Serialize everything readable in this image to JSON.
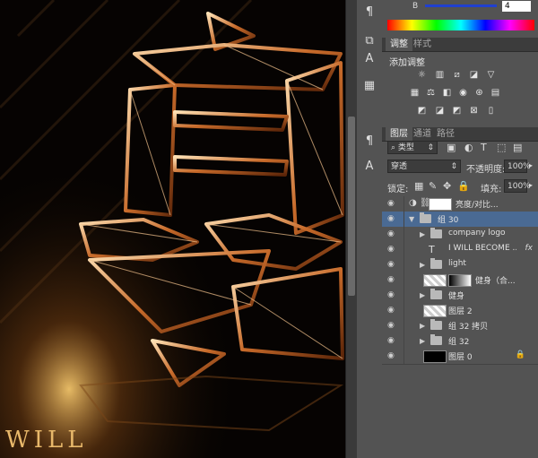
{
  "canvas": {
    "caption": "WILL"
  },
  "color_panel": {
    "channel_label": "B",
    "channel_value": "4"
  },
  "adjustments": {
    "tabs": [
      "调整",
      "样式"
    ],
    "title": "添加调整"
  },
  "layers_panel": {
    "tabs": [
      "图层",
      "通道",
      "路径"
    ],
    "filter_label": "类型",
    "blend_mode": "穿透",
    "opacity_label": "不透明度:",
    "opacity_value": "100%",
    "lock_label": "锁定:",
    "fill_label": "填充:",
    "fill_value": "100%",
    "layers": [
      {
        "name": "亮度/对比...",
        "kind": "adjustment",
        "indent": 0
      },
      {
        "name": "组 30",
        "kind": "group-open",
        "indent": 0,
        "selected": true
      },
      {
        "name": "company logo",
        "kind": "group",
        "indent": 1
      },
      {
        "name": "I WILL  BECOME ...",
        "kind": "text",
        "indent": 1,
        "fx": "fx"
      },
      {
        "name": "light",
        "kind": "group",
        "indent": 1
      },
      {
        "name": "健身（合...",
        "kind": "masked",
        "indent": 1
      },
      {
        "name": "健身",
        "kind": "group",
        "indent": 1
      },
      {
        "name": "图层 2",
        "kind": "layer",
        "indent": 1
      },
      {
        "name": "组 32 拷贝",
        "kind": "group",
        "indent": 1
      },
      {
        "name": "组 32",
        "kind": "group",
        "indent": 1
      },
      {
        "name": "图层 0",
        "kind": "layer-black",
        "indent": 1,
        "locked": true
      }
    ]
  },
  "colors": {
    "selection": "#4a6a93",
    "panel_bg": "#535353",
    "accent_gold": "#e8a04a"
  }
}
